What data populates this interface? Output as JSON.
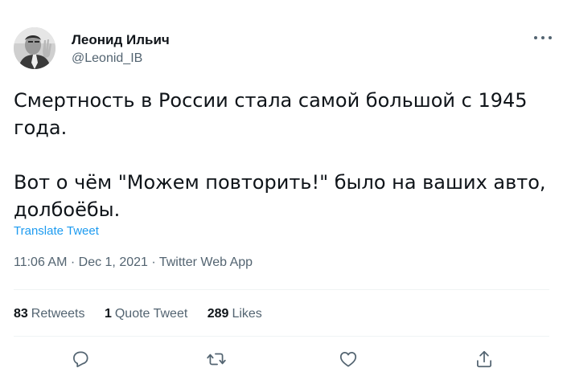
{
  "user": {
    "display_name": "Леонид Ильич",
    "handle": "@Leonid_IB"
  },
  "tweet": {
    "line1": "Смертность в России стала самой большой с 1945 года.",
    "line2": "Вот о чём \"Можем повторить!\" было на ваших авто, долбоёбы.",
    "translate_label": "Translate Tweet",
    "timestamp": "11:06 AM · Dec 1, 2021 · Twitter Web App"
  },
  "stats": {
    "retweets_count": "83",
    "retweets_label": "Retweets",
    "quotes_count": "1",
    "quotes_label": "Quote Tweet",
    "likes_count": "289",
    "likes_label": "Likes"
  },
  "icons": {
    "reply": "reply-icon",
    "retweet": "retweet-icon",
    "like": "heart-icon",
    "share": "share-icon",
    "more": "more-icon"
  },
  "colors": {
    "link": "#1d9bf0",
    "secondary_text": "#536471"
  }
}
